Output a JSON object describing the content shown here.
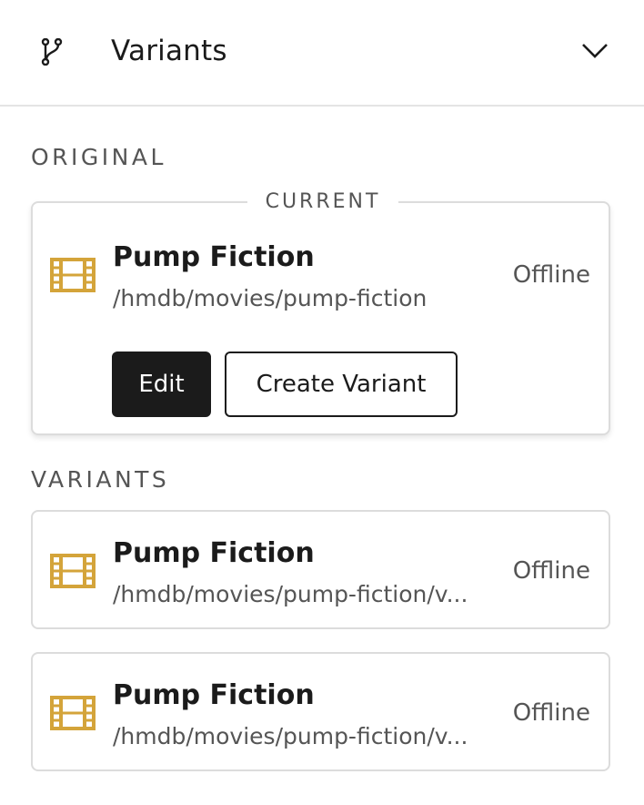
{
  "header": {
    "title": "Variants",
    "icon": "git-branch-icon",
    "toggle_icon": "chevron-down-icon"
  },
  "original": {
    "section_label": "ORIGINAL",
    "legend": "CURRENT",
    "item": {
      "name": "Pump Fiction",
      "path": "/hmdb/movies/pump-fiction",
      "status": "Offline",
      "icon": "film-icon"
    },
    "buttons": {
      "edit": "Edit",
      "create_variant": "Create Variant"
    }
  },
  "variants": {
    "section_label": "VARIANTS",
    "items": [
      {
        "name": "Pump Fiction",
        "path": "/hmdb/movies/pump-fiction/v...",
        "status": "Offline",
        "icon": "film-icon"
      },
      {
        "name": "Pump Fiction",
        "path": "/hmdb/movies/pump-fiction/v...",
        "status": "Offline",
        "icon": "film-icon"
      }
    ]
  },
  "colors": {
    "icon_gold": "#d4a43a",
    "primary_dark": "#1b1b1b",
    "border": "#dcdcdc",
    "muted_text": "#555555"
  }
}
